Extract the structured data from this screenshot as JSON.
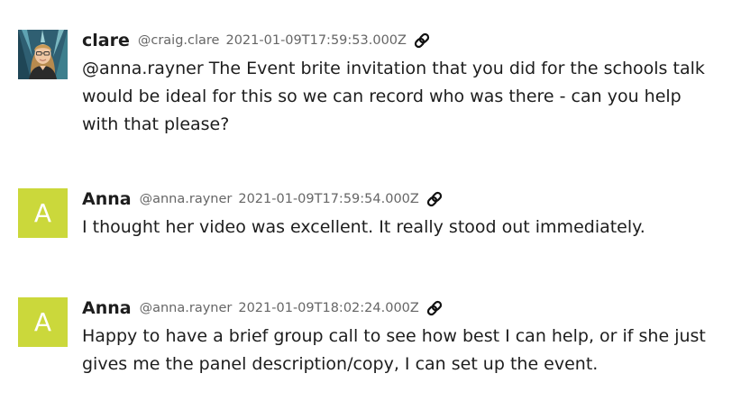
{
  "messages": [
    {
      "name": "clare",
      "handle": "@craig.clare",
      "timestamp": "2021-01-09T17:59:53.000Z",
      "avatar": {
        "type": "photo",
        "icon": "user-photo"
      },
      "link_icon": "chain-link-icon",
      "text": "@anna.rayner The Event brite invitation that you did for the schools talk would be ideal for this so we can record who was there - can you help with that please?"
    },
    {
      "name": "Anna",
      "handle": "@anna.rayner",
      "timestamp": "2021-01-09T17:59:54.000Z",
      "avatar": {
        "type": "letter",
        "letter": "A",
        "color": "#cbd83b"
      },
      "link_icon": "chain-link-icon",
      "text": "I thought her video was excellent. It really stood out immediately."
    },
    {
      "name": "Anna",
      "handle": "@anna.rayner",
      "timestamp": "2021-01-09T18:02:24.000Z",
      "avatar": {
        "type": "letter",
        "letter": "A",
        "color": "#cbd83b"
      },
      "link_icon": "chain-link-icon",
      "text": "Happy to have a brief group call to see how best I can help, or if she just gives me the panel description/copy, I can set up the event."
    }
  ]
}
